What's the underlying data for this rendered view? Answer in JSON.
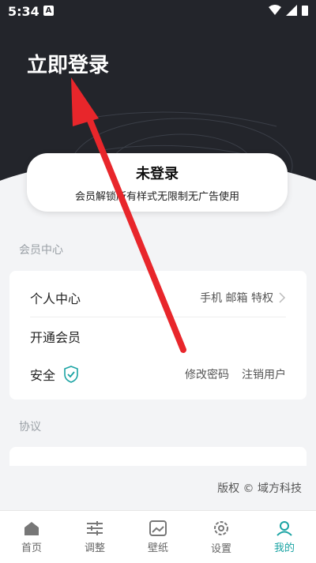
{
  "status": {
    "time": "5:34",
    "notif_letter": "A"
  },
  "hero": {
    "login_title": "立即登录"
  },
  "card": {
    "title": "未登录",
    "subtitle": "会员解锁所有样式无限制无广告使用"
  },
  "member_section": {
    "label": "会员中心",
    "items": [
      {
        "label": "个人中心",
        "right_text": "手机 邮箱 特权"
      },
      {
        "label": "开通会员"
      },
      {
        "label": "安全",
        "right_texts": [
          "修改密码",
          "注销用户"
        ]
      }
    ]
  },
  "agreement_section": {
    "label": "协议"
  },
  "footer": {
    "copyright": "版权 © 域方科技"
  },
  "tabs": [
    {
      "label": "首页",
      "icon": "home-icon"
    },
    {
      "label": "调整",
      "icon": "sliders-icon"
    },
    {
      "label": "壁纸",
      "icon": "image-icon"
    },
    {
      "label": "设置",
      "icon": "gear-icon"
    },
    {
      "label": "我的",
      "icon": "user-icon",
      "active": true
    }
  ],
  "colors": {
    "accent": "#1aa3a3",
    "hero_bg": "#23252b",
    "arrow": "#e8262b"
  }
}
